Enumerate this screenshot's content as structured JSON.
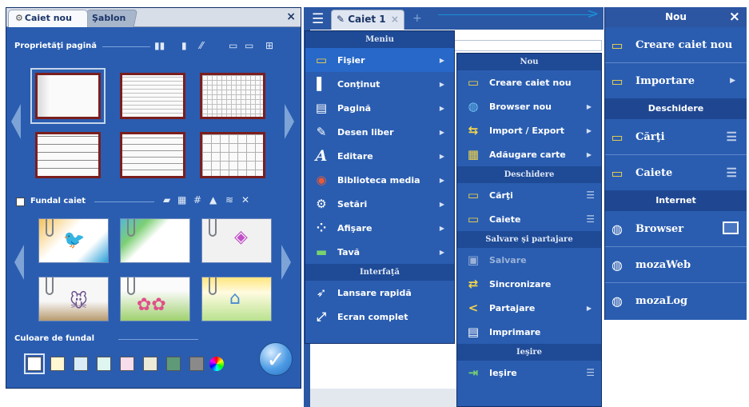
{
  "left_panel": {
    "tabs": [
      "Caiet nou",
      "Şablon"
    ],
    "close": "×",
    "page_props_label": "Proprietăţi pagină",
    "notebook_bg_label": "Fundal caiet",
    "bg_color_label": "Culoare de fundal",
    "page_types": [
      "blank",
      "narrow-lines",
      "small-grid",
      "wide-lines",
      "medium-lines",
      "big-grid"
    ],
    "selected_page": 0,
    "swatches": [
      "#ffffff",
      "#fff8d2",
      "#d9ecf8",
      "#dff5f0",
      "#f7dceb",
      "#ebebd8",
      "#5e9a78",
      "#8a8a8a"
    ],
    "selected_swatch": 0,
    "ok_glyph": "✓"
  },
  "topbar": {
    "doc_tab": "Caiet 1",
    "doc_tab_close": "×",
    "plus": "+"
  },
  "menu": {
    "title": "Meniu",
    "items": [
      {
        "label": "Fişier",
        "icon": "folder-icon",
        "glyph": "▭",
        "arrow": true,
        "highlight": true
      },
      {
        "label": "Conţinut",
        "icon": "content-icon",
        "glyph": "▌",
        "arrow": true
      },
      {
        "label": "Pagină",
        "icon": "page-icon",
        "glyph": "▤",
        "arrow": true
      },
      {
        "label": "Desen liber",
        "icon": "pencil-icon",
        "glyph": "✎",
        "arrow": true
      },
      {
        "label": "Editare",
        "icon": "text-edit-icon",
        "glyph": "A",
        "arrow": true
      },
      {
        "label": "Biblioteca media",
        "icon": "media-icon",
        "glyph": "◉",
        "arrow": true
      },
      {
        "label": "Setări",
        "icon": "gear-icon",
        "glyph": "⚙",
        "arrow": true
      },
      {
        "label": "Afişare",
        "icon": "display-icon",
        "glyph": "⁘",
        "arrow": true
      },
      {
        "label": "Tavă",
        "icon": "tray-icon",
        "glyph": "▬",
        "arrow": true
      }
    ],
    "section2": "Interfaţă",
    "items2": [
      {
        "label": "Lansare rapidă",
        "icon": "rocket-icon",
        "glyph": "➶"
      },
      {
        "label": "Ecran complet",
        "icon": "fullscreen-icon",
        "glyph": "⤢"
      }
    ]
  },
  "submenu": {
    "sec_nou": "Nou",
    "nou_items": [
      {
        "label": "Creare caiet nou",
        "icon": "new-notebook-icon",
        "glyph": "▭"
      },
      {
        "label": "Browser nou",
        "icon": "globe-icon",
        "glyph": "◍",
        "arrow": true
      },
      {
        "label": "Import / Export",
        "icon": "import-export-icon",
        "glyph": "⇆",
        "arrow": true
      },
      {
        "label": "Adăugare carte",
        "icon": "add-book-icon",
        "glyph": "▦",
        "arrow": true
      }
    ],
    "sec_open": "Deschidere",
    "open_items": [
      {
        "label": "Cărţi",
        "icon": "books-icon",
        "glyph": "▭",
        "ham": true
      },
      {
        "label": "Caiete",
        "icon": "notebooks-icon",
        "glyph": "▭",
        "ham": true
      }
    ],
    "sec_save": "Salvare şi partajare",
    "save_items": [
      {
        "label": "Salvare",
        "icon": "save-icon",
        "glyph": "▣",
        "disabled": true
      },
      {
        "label": "Sincronizare",
        "icon": "sync-icon",
        "glyph": "⇄"
      },
      {
        "label": "Partajare",
        "icon": "share-icon",
        "glyph": "<",
        "arrow": true
      },
      {
        "label": "Imprimare",
        "icon": "print-icon",
        "glyph": "▤"
      }
    ],
    "sec_exit": "Ieşire",
    "exit_items": [
      {
        "label": "Ieşire",
        "icon": "exit-icon",
        "glyph": "⇥",
        "ham": true
      }
    ]
  },
  "right_panel": {
    "title": "Nou",
    "close": "×",
    "nou_items": [
      {
        "label": "Creare caiet nou",
        "icon": "new-notebook-icon",
        "glyph": "▭"
      },
      {
        "label": "Importare",
        "icon": "import-icon",
        "glyph": "▭",
        "arrow": true
      }
    ],
    "sec_open": "Deschidere",
    "open_items": [
      {
        "label": "Cărţi",
        "icon": "books-icon",
        "glyph": "▭",
        "ham": true
      },
      {
        "label": "Caiete",
        "icon": "notebooks-icon",
        "glyph": "▭",
        "ham": true
      }
    ],
    "sec_net": "Internet",
    "net_items": [
      {
        "label": "Browser",
        "icon": "globe-icon",
        "glyph": "◍",
        "toggle": true
      },
      {
        "label": "mozaWeb",
        "icon": "globe-icon",
        "glyph": "◍"
      },
      {
        "label": "mozaLog",
        "icon": "globe-icon",
        "glyph": "◍"
      }
    ]
  },
  "colors": {
    "panel_blue": "#2a5db0",
    "header_blue": "#1e4a96",
    "notebook_border": "#7b1e1e",
    "arrow_accent": "#1a8fd6"
  }
}
